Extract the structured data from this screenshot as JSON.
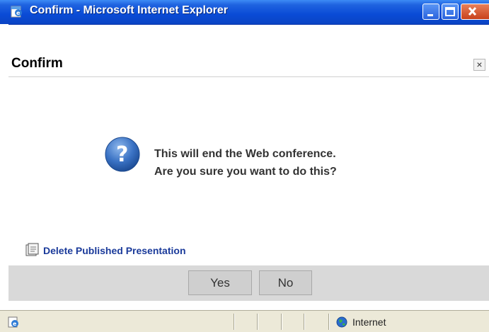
{
  "window": {
    "title": "Confirm - Microsoft Internet Explorer"
  },
  "dialog": {
    "title": "Confirm",
    "close_glyph": "×",
    "icon": "question-icon",
    "message_line1": "This will end the Web conference.",
    "message_line2": "Are you sure you want to do this?",
    "link_label": "Delete Published Presentation",
    "yes_label": "Yes",
    "no_label": "No"
  },
  "statusbar": {
    "zone_label": "Internet"
  },
  "colors": {
    "titlebar": "#0a4bd6",
    "link": "#1a3a9a",
    "button_bar": "#d9d9d9",
    "statusbar": "#ece9d8"
  }
}
